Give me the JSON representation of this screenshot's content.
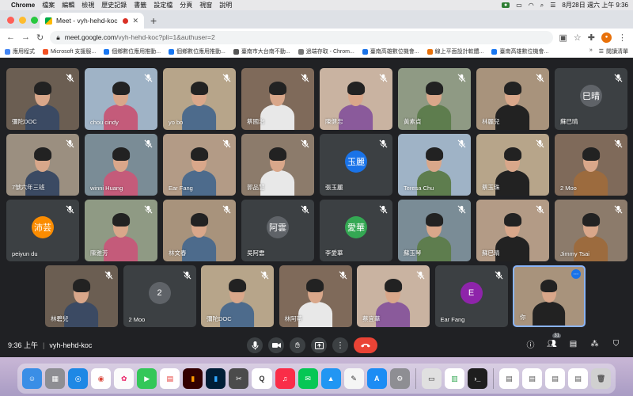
{
  "menubar": {
    "app": "Chrome",
    "items": [
      "檔案",
      "編輯",
      "檢視",
      "歷史記錄",
      "書籤",
      "設定檔",
      "分頁",
      "視窗",
      "說明"
    ],
    "datetime": "8月28日 週六 上午 9:36"
  },
  "tab": {
    "title": "Meet - vyh-hehd-koc"
  },
  "address": {
    "host": "meet.google.com",
    "path": "/vyh-hehd-koc?pli=1&authuser=2"
  },
  "bookmarks": {
    "items": [
      "應用程式",
      "Microsoft 支援服...",
      "個鄉數位應用推動...",
      "個鄉數位應用推動...",
      "臺南市大台南不動...",
      "過端存取 - Chrom...",
      "臺南高雄數位機會...",
      "線上平面設計軟體...",
      "臺南高雄數位機會..."
    ],
    "reading_list": "閱讀清單"
  },
  "participants": [
    {
      "name": "彌陀DOC"
    },
    {
      "name": "chou cindy"
    },
    {
      "name": "yo bo"
    },
    {
      "name": "蔡國治"
    },
    {
      "name": "陳健忠"
    },
    {
      "name": "黃素貞"
    },
    {
      "name": "林麗兒"
    },
    {
      "name": "蘇巳晴",
      "avatar": "巳晴"
    },
    {
      "name": "7號六年三班"
    },
    {
      "name": "winni Huang"
    },
    {
      "name": "Ear Fang"
    },
    {
      "name": "郭品慧"
    },
    {
      "name": "張玉麗",
      "avatar": "玉麗"
    },
    {
      "name": "Teresa Chu"
    },
    {
      "name": "蔡玉珠"
    },
    {
      "name": "2 Moo"
    },
    {
      "name": "peiyun du",
      "avatar": "沛芸"
    },
    {
      "name": "陳雅芳"
    },
    {
      "name": "林文春"
    },
    {
      "name": "吳阿雲",
      "avatar": "阿雲"
    },
    {
      "name": "李愛華",
      "avatar": "愛華"
    },
    {
      "name": "蘇玉琴"
    },
    {
      "name": "蘇巳晴"
    },
    {
      "name": "Jimmy Tsai"
    },
    {
      "name": "林碧兒"
    },
    {
      "name": "2 Moo",
      "avatar": "2"
    },
    {
      "name": "彌陀DOC"
    },
    {
      "name": "林阿蒂"
    },
    {
      "name": "蔡宜華"
    },
    {
      "name": "Ear Fang",
      "avatar": "E"
    },
    {
      "name": "你"
    }
  ],
  "meetbar": {
    "time": "9:36 上午",
    "code": "vyh-hehd-koc",
    "participant_count": "31"
  }
}
